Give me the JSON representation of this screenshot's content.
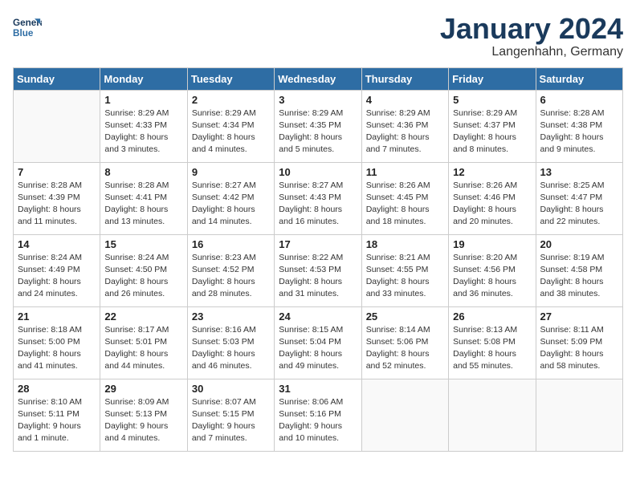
{
  "logo": {
    "line1": "General",
    "line2": "Blue"
  },
  "title": "January 2024",
  "subtitle": "Langenhahn, Germany",
  "days_of_week": [
    "Sunday",
    "Monday",
    "Tuesday",
    "Wednesday",
    "Thursday",
    "Friday",
    "Saturday"
  ],
  "weeks": [
    [
      {
        "day": "",
        "empty": true
      },
      {
        "day": "1",
        "sunrise": "8:29 AM",
        "sunset": "4:33 PM",
        "daylight": "8 hours and 3 minutes."
      },
      {
        "day": "2",
        "sunrise": "8:29 AM",
        "sunset": "4:34 PM",
        "daylight": "8 hours and 4 minutes."
      },
      {
        "day": "3",
        "sunrise": "8:29 AM",
        "sunset": "4:35 PM",
        "daylight": "8 hours and 5 minutes."
      },
      {
        "day": "4",
        "sunrise": "8:29 AM",
        "sunset": "4:36 PM",
        "daylight": "8 hours and 7 minutes."
      },
      {
        "day": "5",
        "sunrise": "8:29 AM",
        "sunset": "4:37 PM",
        "daylight": "8 hours and 8 minutes."
      },
      {
        "day": "6",
        "sunrise": "8:28 AM",
        "sunset": "4:38 PM",
        "daylight": "8 hours and 9 minutes."
      }
    ],
    [
      {
        "day": "7",
        "sunrise": "8:28 AM",
        "sunset": "4:39 PM",
        "daylight": "8 hours and 11 minutes."
      },
      {
        "day": "8",
        "sunrise": "8:28 AM",
        "sunset": "4:41 PM",
        "daylight": "8 hours and 13 minutes."
      },
      {
        "day": "9",
        "sunrise": "8:27 AM",
        "sunset": "4:42 PM",
        "daylight": "8 hours and 14 minutes."
      },
      {
        "day": "10",
        "sunrise": "8:27 AM",
        "sunset": "4:43 PM",
        "daylight": "8 hours and 16 minutes."
      },
      {
        "day": "11",
        "sunrise": "8:26 AM",
        "sunset": "4:45 PM",
        "daylight": "8 hours and 18 minutes."
      },
      {
        "day": "12",
        "sunrise": "8:26 AM",
        "sunset": "4:46 PM",
        "daylight": "8 hours and 20 minutes."
      },
      {
        "day": "13",
        "sunrise": "8:25 AM",
        "sunset": "4:47 PM",
        "daylight": "8 hours and 22 minutes."
      }
    ],
    [
      {
        "day": "14",
        "sunrise": "8:24 AM",
        "sunset": "4:49 PM",
        "daylight": "8 hours and 24 minutes."
      },
      {
        "day": "15",
        "sunrise": "8:24 AM",
        "sunset": "4:50 PM",
        "daylight": "8 hours and 26 minutes."
      },
      {
        "day": "16",
        "sunrise": "8:23 AM",
        "sunset": "4:52 PM",
        "daylight": "8 hours and 28 minutes."
      },
      {
        "day": "17",
        "sunrise": "8:22 AM",
        "sunset": "4:53 PM",
        "daylight": "8 hours and 31 minutes."
      },
      {
        "day": "18",
        "sunrise": "8:21 AM",
        "sunset": "4:55 PM",
        "daylight": "8 hours and 33 minutes."
      },
      {
        "day": "19",
        "sunrise": "8:20 AM",
        "sunset": "4:56 PM",
        "daylight": "8 hours and 36 minutes."
      },
      {
        "day": "20",
        "sunrise": "8:19 AM",
        "sunset": "4:58 PM",
        "daylight": "8 hours and 38 minutes."
      }
    ],
    [
      {
        "day": "21",
        "sunrise": "8:18 AM",
        "sunset": "5:00 PM",
        "daylight": "8 hours and 41 minutes."
      },
      {
        "day": "22",
        "sunrise": "8:17 AM",
        "sunset": "5:01 PM",
        "daylight": "8 hours and 44 minutes."
      },
      {
        "day": "23",
        "sunrise": "8:16 AM",
        "sunset": "5:03 PM",
        "daylight": "8 hours and 46 minutes."
      },
      {
        "day": "24",
        "sunrise": "8:15 AM",
        "sunset": "5:04 PM",
        "daylight": "8 hours and 49 minutes."
      },
      {
        "day": "25",
        "sunrise": "8:14 AM",
        "sunset": "5:06 PM",
        "daylight": "8 hours and 52 minutes."
      },
      {
        "day": "26",
        "sunrise": "8:13 AM",
        "sunset": "5:08 PM",
        "daylight": "8 hours and 55 minutes."
      },
      {
        "day": "27",
        "sunrise": "8:11 AM",
        "sunset": "5:09 PM",
        "daylight": "8 hours and 58 minutes."
      }
    ],
    [
      {
        "day": "28",
        "sunrise": "8:10 AM",
        "sunset": "5:11 PM",
        "daylight": "9 hours and 1 minute."
      },
      {
        "day": "29",
        "sunrise": "8:09 AM",
        "sunset": "5:13 PM",
        "daylight": "9 hours and 4 minutes."
      },
      {
        "day": "30",
        "sunrise": "8:07 AM",
        "sunset": "5:15 PM",
        "daylight": "9 hours and 7 minutes."
      },
      {
        "day": "31",
        "sunrise": "8:06 AM",
        "sunset": "5:16 PM",
        "daylight": "9 hours and 10 minutes."
      },
      {
        "day": "",
        "empty": true
      },
      {
        "day": "",
        "empty": true
      },
      {
        "day": "",
        "empty": true
      }
    ]
  ]
}
